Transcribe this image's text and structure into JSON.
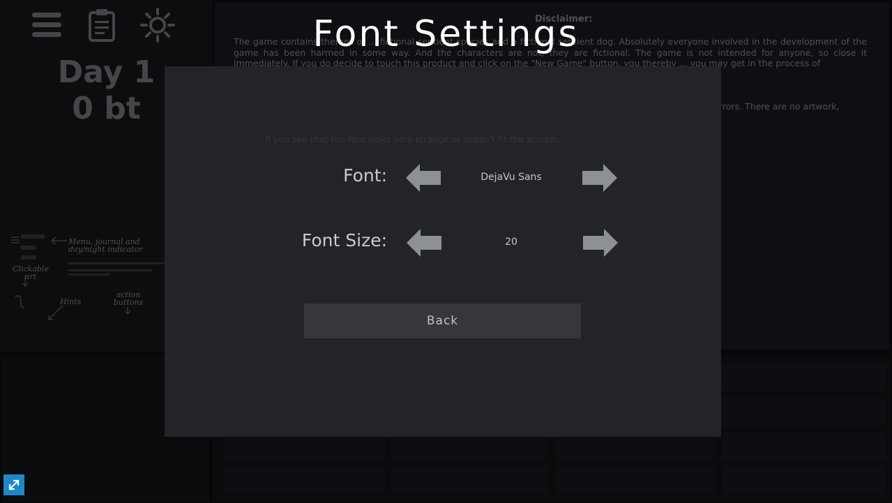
{
  "background": {
    "day_label": "Day 1",
    "bt_label": "0 bt",
    "disclaimer_title": "Disclaimer:",
    "disclaimer_text": "The game contains themes of ... fictional sentient species and a fictional sentient dog. Absolutely everyone involved in the development of the game has been harmed in some way. And the characters are not, they are fictional. The game is not intended for anyone, so close it immediately. If you do decide to touch this product and click on the \"New Game\" button, you thereby ... you may get in the process of",
    "disclaimer_text_2": "ing errors. There are no artwork,",
    "tutorial": {
      "menu_note": "Menu, journal and day/night indicator",
      "art_note": "Clickable art",
      "hints_note": "Hints",
      "action_note": "action buttons"
    },
    "icons": [
      "hamburger-menu-icon",
      "clipboard-journal-icon",
      "sun-icon",
      "fullscreen-expand-icon"
    ]
  },
  "modal": {
    "title": "Font Settings",
    "font_label": "Font:",
    "font_value": "DejaVu Sans",
    "size_label": "Font Size:",
    "size_value": "20",
    "back_label": "Back",
    "faint_text": "If you see that the font looks very strange or doesn't fit the screen..."
  },
  "colors": {
    "modal_bg": "#232428",
    "arrow": "#8e9098",
    "back_button": "#36373d",
    "expand_button": "#1c87c9"
  }
}
